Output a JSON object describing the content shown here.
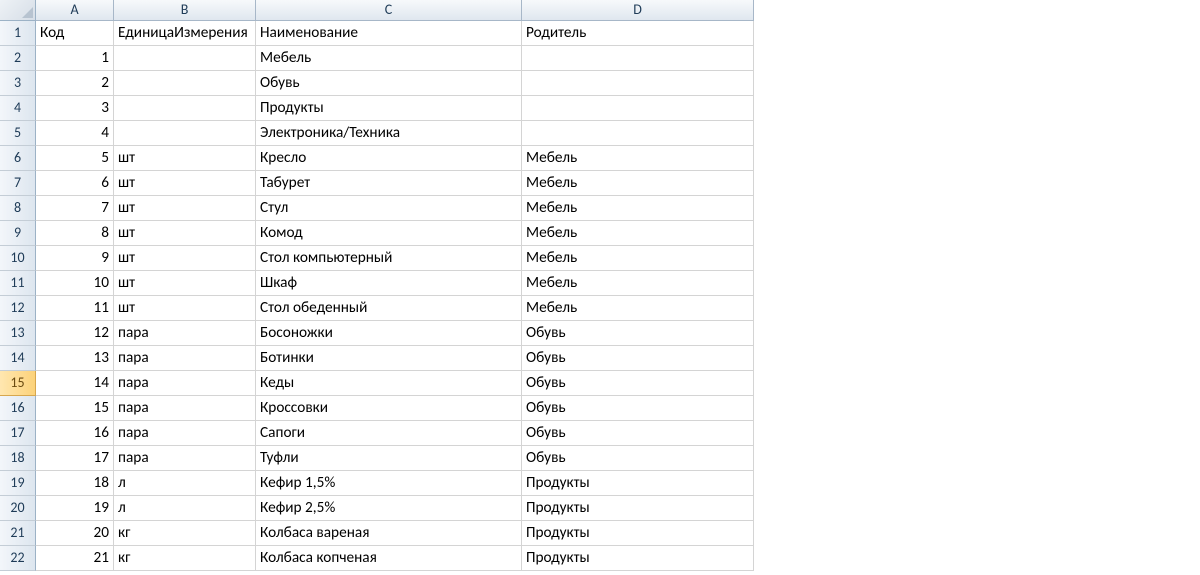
{
  "columns": [
    "A",
    "B",
    "C",
    "D"
  ],
  "headerRow": [
    "Код",
    "ЕдиницаИзмерения",
    "Наименование",
    "Родитель"
  ],
  "activeRow": 15,
  "rows": [
    {
      "n": 1,
      "A": "Код",
      "B": "ЕдиницаИзмерения",
      "C": "Наименование",
      "D": "Родитель",
      "isHeader": true
    },
    {
      "n": 2,
      "A": "1",
      "B": "",
      "C": "Мебель",
      "D": ""
    },
    {
      "n": 3,
      "A": "2",
      "B": "",
      "C": "Обувь",
      "D": ""
    },
    {
      "n": 4,
      "A": "3",
      "B": "",
      "C": "Продукты",
      "D": ""
    },
    {
      "n": 5,
      "A": "4",
      "B": "",
      "C": "Электроника/Техника",
      "D": ""
    },
    {
      "n": 6,
      "A": "5",
      "B": "шт",
      "C": "Кресло",
      "D": "Мебель"
    },
    {
      "n": 7,
      "A": "6",
      "B": "шт",
      "C": "Табурет",
      "D": "Мебель"
    },
    {
      "n": 8,
      "A": "7",
      "B": "шт",
      "C": "Стул",
      "D": "Мебель"
    },
    {
      "n": 9,
      "A": "8",
      "B": "шт",
      "C": "Комод",
      "D": "Мебель"
    },
    {
      "n": 10,
      "A": "9",
      "B": "шт",
      "C": "Стол компьютерный",
      "D": "Мебель"
    },
    {
      "n": 11,
      "A": "10",
      "B": "шт",
      "C": "Шкаф",
      "D": "Мебель"
    },
    {
      "n": 12,
      "A": "11",
      "B": "шт",
      "C": "Стол обеденный",
      "D": "Мебель"
    },
    {
      "n": 13,
      "A": "12",
      "B": "пара",
      "C": "Босоножки",
      "D": "Обувь"
    },
    {
      "n": 14,
      "A": "13",
      "B": "пара",
      "C": "Ботинки",
      "D": "Обувь"
    },
    {
      "n": 15,
      "A": "14",
      "B": "пара",
      "C": "Кеды",
      "D": "Обувь"
    },
    {
      "n": 16,
      "A": "15",
      "B": "пара",
      "C": "Кроссовки",
      "D": "Обувь"
    },
    {
      "n": 17,
      "A": "16",
      "B": "пара",
      "C": "Сапоги",
      "D": "Обувь"
    },
    {
      "n": 18,
      "A": "17",
      "B": "пара",
      "C": "Туфли",
      "D": "Обувь"
    },
    {
      "n": 19,
      "A": "18",
      "B": "л",
      "C": "Кефир 1,5%",
      "D": "Продукты"
    },
    {
      "n": 20,
      "A": "19",
      "B": "л",
      "C": "Кефир 2,5%",
      "D": "Продукты"
    },
    {
      "n": 21,
      "A": "20",
      "B": "кг",
      "C": "Колбаса вареная",
      "D": "Продукты"
    },
    {
      "n": 22,
      "A": "21",
      "B": "кг",
      "C": "Колбаса копченая",
      "D": "Продукты"
    }
  ]
}
